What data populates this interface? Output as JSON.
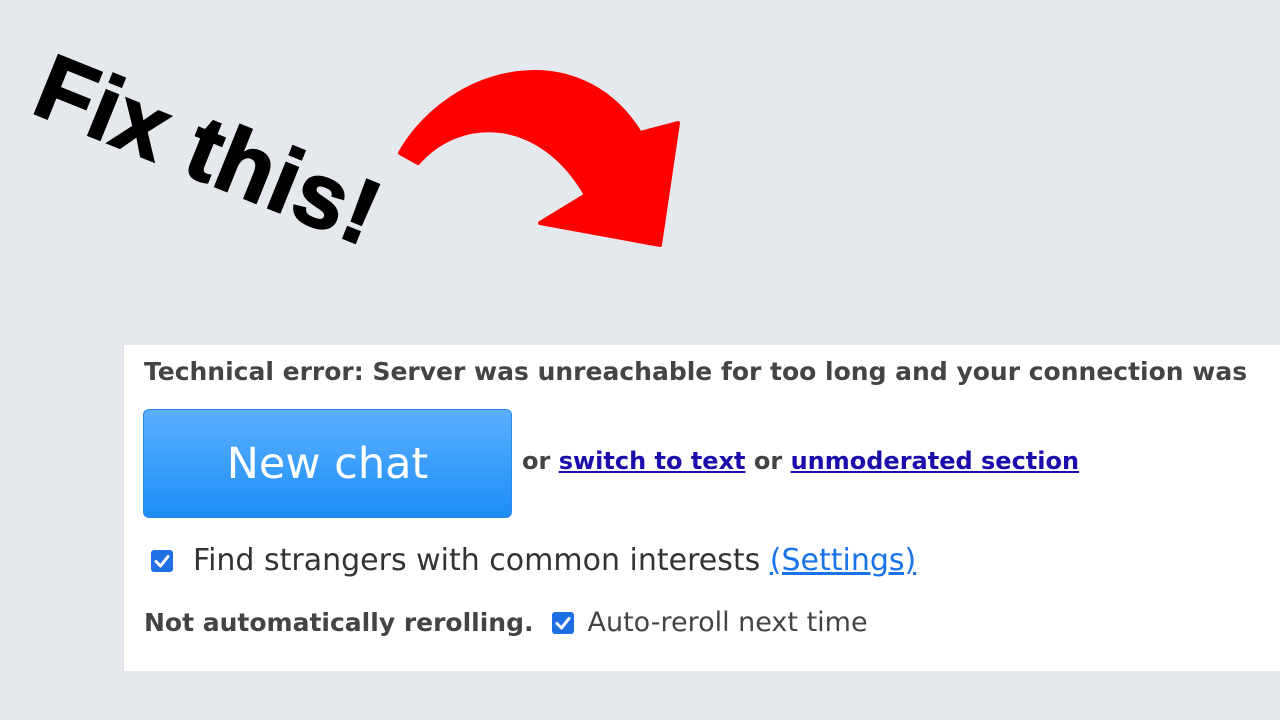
{
  "annotation": {
    "headline": "Fix this!"
  },
  "panel": {
    "error_text": "Technical error: Server was unreachable for too long and your connection was",
    "new_chat_label": "New chat",
    "or_1": "or",
    "switch_link": "switch to text",
    "or_2": "or",
    "unmoderated_link": "unmoderated section",
    "interests_label": "Find strangers with common interests",
    "settings_link": "(Settings)",
    "reroll_status": "Not automatically rerolling.",
    "auto_reroll_label": "Auto-reroll next time"
  },
  "colors": {
    "background": "#e5e9ed",
    "arrow": "#ff0000",
    "button": "#3b9cf7",
    "link": "#1a0dab",
    "checkbox": "#1f6fe5"
  }
}
